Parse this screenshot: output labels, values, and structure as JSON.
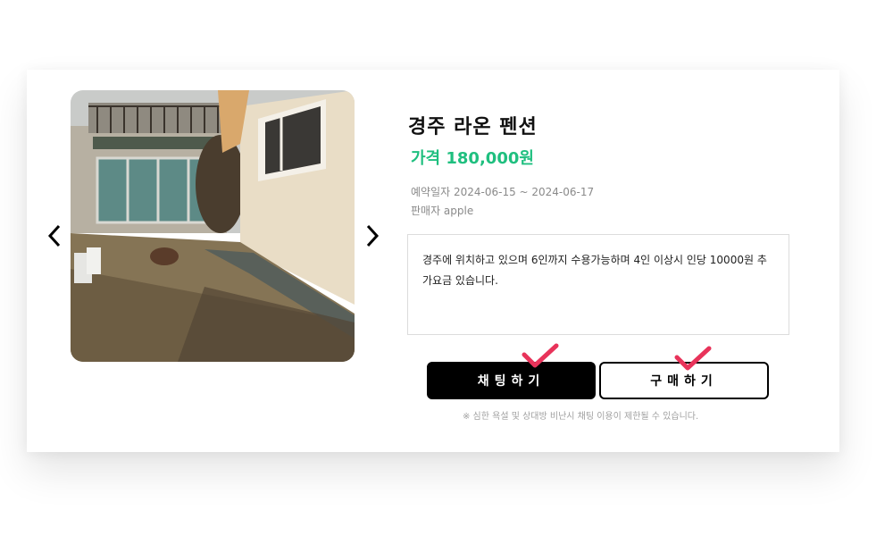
{
  "product": {
    "title": "경주 라온 펜션",
    "price": "가격 180,000원",
    "reservation": "예약일자 2024-06-15 ~ 2024-06-17",
    "seller": "판매자 apple",
    "description": "경주에 위치하고 있으며 6인까지 수용가능하며 4인 이상시 인당 10000원 추가요금 있습니다."
  },
  "actions": {
    "chat_label": "채팅하기",
    "buy_label": "구매하기"
  },
  "notice": "※ 심한 욕설 및 상대방 비난시 채팅 이용이 제한될 수 있습니다.",
  "icons": {
    "prev": "chevron-left-icon",
    "next": "chevron-right-icon",
    "check": "check-mark-icon"
  },
  "colors": {
    "price": "#1fbf7f",
    "check": "#e8335a",
    "primary_button": "#000000"
  }
}
